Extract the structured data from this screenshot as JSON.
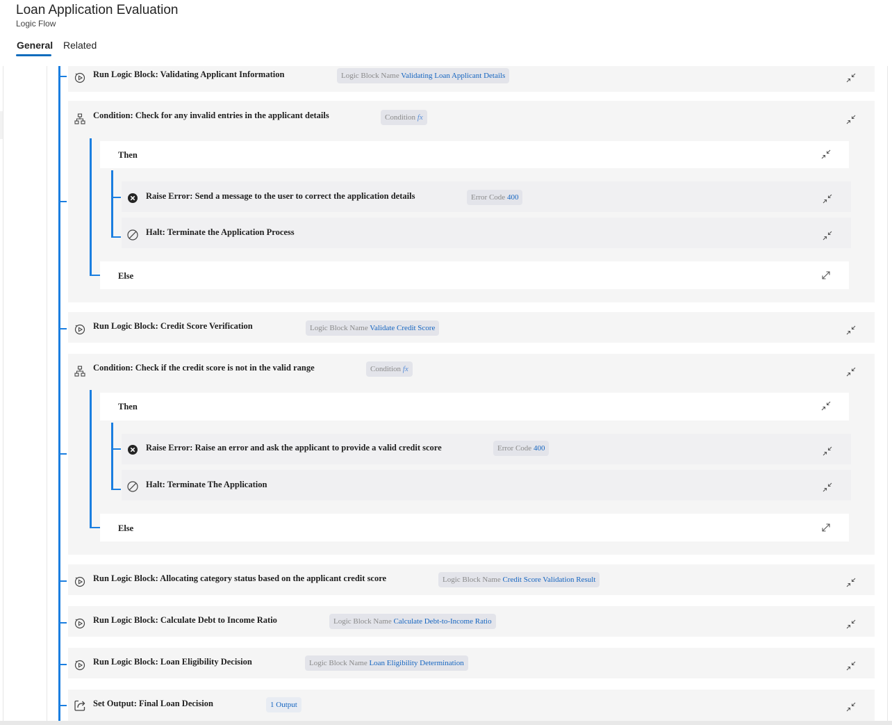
{
  "header": {
    "title": "Loan Application Evaluation",
    "subtitle": "Logic Flow",
    "tabs": [
      {
        "label": "General",
        "active": true
      },
      {
        "label": "Related",
        "active": false
      }
    ]
  },
  "theme": {
    "accent": "#0f6cbd",
    "connector": "#1a7ee0",
    "link": "#1565c0"
  },
  "steps": {
    "s1": {
      "label": "Run Logic Block: Validating Applicant Information",
      "chip_key": "Logic Block Name",
      "chip_val": "Validating Loan Applicant Details",
      "icon": "run-logic-icon"
    },
    "s2": {
      "label": "Condition: Check for any invalid entries in the applicant details",
      "chip_key": "Condition",
      "chip_fx": "fx",
      "icon": "condition-icon",
      "then": "Then",
      "else": "Else",
      "a1": {
        "label": "Raise Error: Send a message to the user to correct the application details",
        "chip_key": "Error Code",
        "chip_val": "400",
        "icon": "error-icon"
      },
      "a2": {
        "label": "Halt: Terminate the Application Process",
        "icon": "halt-icon"
      }
    },
    "s3": {
      "label": "Run Logic Block: Credit Score Verification",
      "chip_key": "Logic Block Name",
      "chip_val": "Validate Credit Score",
      "icon": "run-logic-icon"
    },
    "s4": {
      "label": "Condition: Check if the credit score is not in the valid range",
      "chip_key": "Condition",
      "chip_fx": "fx",
      "icon": "condition-icon",
      "then": "Then",
      "else": "Else",
      "a1": {
        "label": "Raise Error: Raise an error and ask the applicant to provide a valid credit score",
        "chip_key": "Error Code",
        "chip_val": "400",
        "icon": "error-icon"
      },
      "a2": {
        "label": "Halt: Terminate The Application",
        "icon": "halt-icon"
      }
    },
    "s5": {
      "label": "Run Logic Block: Allocating category status based on the applicant credit score",
      "chip_key": "Logic Block Name",
      "chip_val": "Credit Score Validation Result",
      "icon": "run-logic-icon"
    },
    "s6": {
      "label": "Run Logic Block: Calculate Debt to Income Ratio",
      "chip_key": "Logic Block Name",
      "chip_val": "Calculate Debt-to-Income Ratio",
      "icon": "run-logic-icon"
    },
    "s7": {
      "label": "Run Logic Block: Loan Eligibility Decision",
      "chip_key": "Logic Block Name",
      "chip_val": "Loan Eligibility Determination",
      "icon": "run-logic-icon"
    },
    "s8": {
      "label": "Set Output: Final Loan Decision",
      "chip_val": "1 Output",
      "icon": "set-output-icon"
    }
  }
}
